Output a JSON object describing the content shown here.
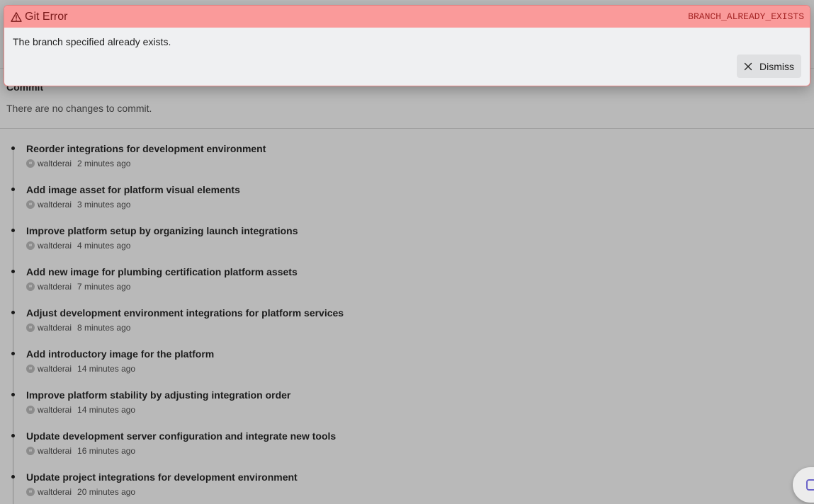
{
  "toast": {
    "title": "Git Error",
    "code": "BRANCH_ALREADY_EXISTS",
    "message": "The branch specified already exists.",
    "dismiss_label": "Dismiss",
    "colors": {
      "header_bg": "#fa9a9a",
      "title": "#7a1a1a",
      "code": "#a52525"
    }
  },
  "commit_section": {
    "title": "Commit",
    "empty_message": "There are no changes to commit."
  },
  "history": {
    "commits": [
      {
        "message": "Reorder integrations for development environment",
        "author": "waltderai",
        "time": "2 minutes ago"
      },
      {
        "message": "Add image asset for platform visual elements",
        "author": "waltderai",
        "time": "3 minutes ago"
      },
      {
        "message": "Improve platform setup by organizing launch integrations",
        "author": "waltderai",
        "time": "4 minutes ago"
      },
      {
        "message": "Add new image for plumbing certification platform assets",
        "author": "waltderai",
        "time": "7 minutes ago"
      },
      {
        "message": "Adjust development environment integrations for platform services",
        "author": "waltderai",
        "time": "8 minutes ago"
      },
      {
        "message": "Add introductory image for the platform",
        "author": "waltderai",
        "time": "14 minutes ago"
      },
      {
        "message": "Improve platform stability by adjusting integration order",
        "author": "waltderai",
        "time": "14 minutes ago"
      },
      {
        "message": "Update development server configuration and integrate new tools",
        "author": "waltderai",
        "time": "16 minutes ago"
      },
      {
        "message": "Update project integrations for development environment",
        "author": "waltderai",
        "time": "20 minutes ago"
      }
    ]
  },
  "icons": {
    "warning": "warning-triangle-icon",
    "dismiss": "close-icon",
    "avatar": "user-avatar-icon"
  }
}
